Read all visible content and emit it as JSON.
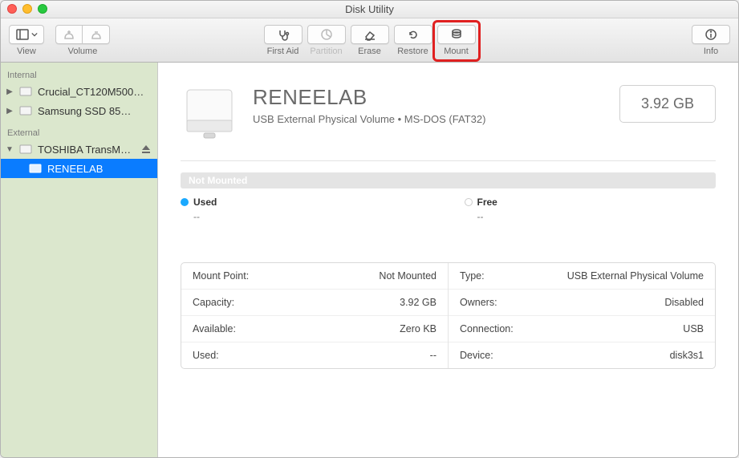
{
  "window_title": "Disk Utility",
  "toolbar": {
    "view_label": "View",
    "volume_label": "Volume",
    "first_aid": "First Aid",
    "partition": "Partition",
    "erase": "Erase",
    "restore": "Restore",
    "mount": "Mount",
    "info": "Info"
  },
  "sidebar": {
    "internal_label": "Internal",
    "external_label": "External",
    "internal": [
      {
        "name": "Crucial_CT120M500…"
      },
      {
        "name": "Samsung SSD 85…"
      }
    ],
    "external": [
      {
        "name": "TOSHIBA TransM…",
        "ejectable": true
      },
      {
        "name": "RENEELAB",
        "selected": true
      }
    ]
  },
  "volume": {
    "name": "RENEELAB",
    "subtitle": "USB External Physical Volume • MS-DOS (FAT32)",
    "size": "3.92 GB",
    "status": "Not Mounted",
    "usage": {
      "used_label": "Used",
      "used_value": "--",
      "used_color": "#1aa9ff",
      "free_label": "Free",
      "free_value": "--",
      "free_color": "#ffffff"
    },
    "details_left": [
      {
        "label": "Mount Point:",
        "value": "Not Mounted"
      },
      {
        "label": "Capacity:",
        "value": "3.92 GB"
      },
      {
        "label": "Available:",
        "value": "Zero KB"
      },
      {
        "label": "Used:",
        "value": "--"
      }
    ],
    "details_right": [
      {
        "label": "Type:",
        "value": "USB External Physical Volume"
      },
      {
        "label": "Owners:",
        "value": "Disabled"
      },
      {
        "label": "Connection:",
        "value": "USB"
      },
      {
        "label": "Device:",
        "value": "disk3s1"
      }
    ]
  }
}
